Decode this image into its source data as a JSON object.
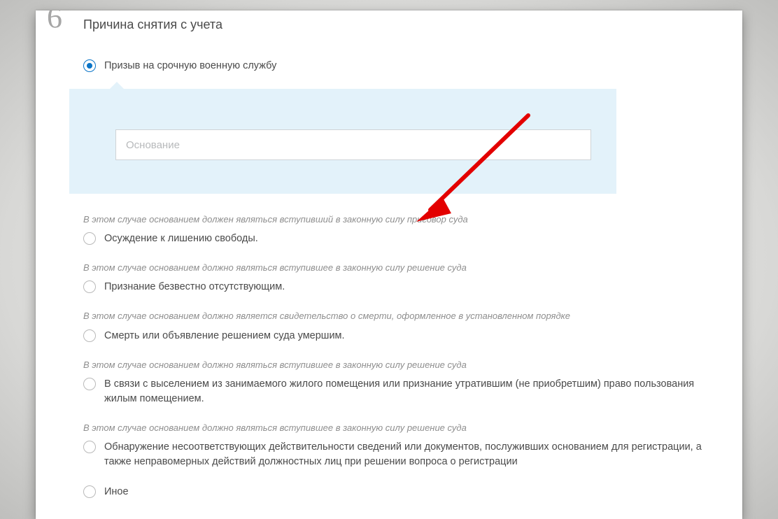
{
  "step": {
    "number": "6",
    "title": "Причина снятия с учета"
  },
  "reason_input": {
    "placeholder": "Основание",
    "value": ""
  },
  "options": [
    {
      "label": "Призыв на срочную военную службу",
      "selected": true,
      "note": ""
    },
    {
      "label": "Осуждение к лишению свободы.",
      "selected": false,
      "note": "В этом случае основанием должен являться вступивший в законную силу приговор суда"
    },
    {
      "label": "Признание безвестно отсутствующим.",
      "selected": false,
      "note": "В этом случае основанием должно являться вступившее в законную силу решение суда"
    },
    {
      "label": "Смерть или объявление решением суда умершим.",
      "selected": false,
      "note": "В этом случае основанием должно является свидетельство о смерти, оформленное в установленном порядке"
    },
    {
      "label": "В связи с выселением из занимаемого жилого помещения или признание утратившим (не приобретшим) право пользования жилым помещением.",
      "selected": false,
      "note": "В этом случае основанием должно являться вступившее в законную силу решение суда"
    },
    {
      "label": "Обнаружение несоответствующих действительности сведений или документов, послуживших основанием для регистрации, а также неправомерных действий должностных лиц при решении вопроса о регистрации",
      "selected": false,
      "note": "В этом случае основанием должно являться вступившее в законную силу решение суда"
    },
    {
      "label": "Иное",
      "selected": false,
      "note": ""
    }
  ]
}
